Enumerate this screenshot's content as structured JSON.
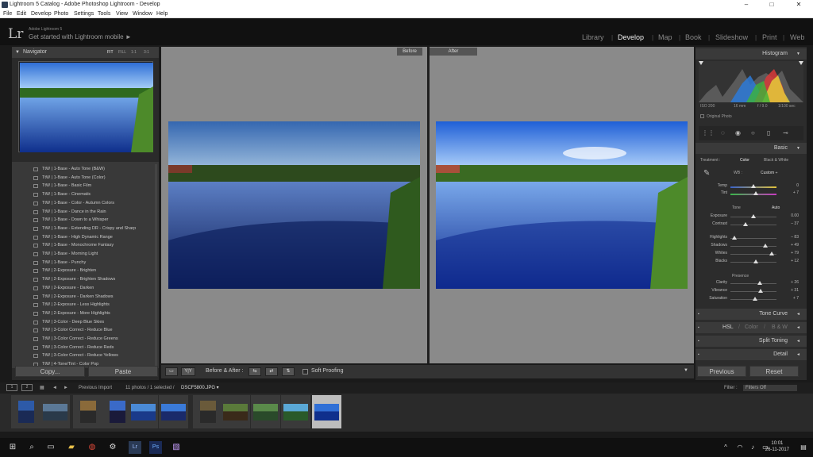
{
  "window": {
    "title": "Lightroom 5 Catalog - Adobe Photoshop Lightroom - Develop",
    "min": "–",
    "max": "□",
    "close": "✕"
  },
  "menu": [
    "File",
    "Edit",
    "Develop",
    "Photo",
    "Settings",
    "Tools",
    "View",
    "Window",
    "Help"
  ],
  "header": {
    "logo": "Lr",
    "brand": "Adobe Lightroom 5",
    "mobile": "Get started with Lightroom mobile ►",
    "modules": [
      "Library",
      "Develop",
      "Map",
      "Book",
      "Slideshow",
      "Print",
      "Web"
    ],
    "active_module": "Develop"
  },
  "navigator": {
    "title": "Navigator",
    "zoom": [
      "FIT",
      "FILL",
      "1:1",
      "3:1"
    ]
  },
  "presets": [
    "TtW | 1-Base - Auto Tone (B&W)",
    "TtW | 1-Base - Auto Tone (Color)",
    "TtW | 1-Base - Basic Film",
    "TtW | 1-Base - Cinematic",
    "TtW | 1-Base - Color - Autumn Colors",
    "TtW | 1-Base - Dance in the Rain",
    "TtW | 1-Base - Down to a Whisper",
    "TtW | 1-Base - Extending DR - Crispy and Sharp",
    "TtW | 1-Base - High Dynamic Range",
    "TtW | 1-Base - Monochrome Fantasy",
    "TtW | 1-Base - Morning Light",
    "TtW | 1-Base - Punchy",
    "TtW | 2-Exposure - Brighten",
    "TtW | 2-Exposure - Brighten Shadows",
    "TtW | 2-Exposure - Darken",
    "TtW | 2-Exposure - Darken Shadows",
    "TtW | 2-Exposure - Less Highlights",
    "TtW | 2-Exposure - More Highlights",
    "TtW | 3-Color - Deep Blue Skies",
    "TtW | 3-Color Correct - Reduce Blue",
    "TtW | 3-Color Correct - Reduce Greens",
    "TtW | 3-Color Correct - Reduce Reds",
    "TtW | 3-Color Correct - Reduce Yellows",
    "TtW | 4-Tone/Tint - Color Pop"
  ],
  "left_buttons": {
    "copy": "Copy...",
    "paste": "Paste"
  },
  "view": {
    "before": "Before",
    "after": "After"
  },
  "toolbar": {
    "before_after": "Before & After :",
    "soft_proofing": "Soft Proofing",
    "yy": "Y|Y"
  },
  "histogram": {
    "title": "Histogram",
    "iso": "ISO 200",
    "focal": "16 mm",
    "aperture": "f / 9.0",
    "shutter": "1/100 sec",
    "original_photo": "Original Photo"
  },
  "basic": {
    "title": "Basic",
    "treatment": "Treatment :",
    "color": "Color",
    "bw": "Black & White",
    "wb_label": "WB :",
    "wb_value": "Custom ÷",
    "tone": "Tone",
    "auto": "Auto",
    "presence": "Presence",
    "sliders": [
      {
        "name": "Temp",
        "value": "0",
        "pos": 0.5
      },
      {
        "name": "Tint",
        "value": "+ 7",
        "pos": 0.55
      },
      {
        "name": "Exposure",
        "value": "0.00",
        "pos": 0.5
      },
      {
        "name": "Contrast",
        "value": "– 37",
        "pos": 0.32
      },
      {
        "name": "Highlights",
        "value": "– 83",
        "pos": 0.09
      },
      {
        "name": "Shadows",
        "value": "+ 49",
        "pos": 0.75
      },
      {
        "name": "Whites",
        "value": "+ 79",
        "pos": 0.9
      },
      {
        "name": "Blacks",
        "value": "+ 12",
        "pos": 0.56
      },
      {
        "name": "Clarity",
        "value": "+ 26",
        "pos": 0.63
      },
      {
        "name": "Vibrance",
        "value": "+ 31",
        "pos": 0.66
      },
      {
        "name": "Saturation",
        "value": "+ 7",
        "pos": 0.54
      }
    ]
  },
  "panels": {
    "tone_curve": "Tone Curve",
    "hsl": "HSL",
    "hsl_color": "Color",
    "hsl_bw": "B & W",
    "split_toning": "Split Toning",
    "detail": "Detail"
  },
  "right_buttons": {
    "previous": "Previous",
    "reset": "Reset"
  },
  "filmstrip_bar": {
    "previous_import": "Previous Import",
    "count": "11 photos / 1 selected /",
    "filename": "DSCF5800.JPG ▾",
    "filter_label": "Filter :",
    "filter_value": "Filters Off"
  },
  "taskbar": {
    "time": "10:01",
    "date": "26-11-2017"
  }
}
